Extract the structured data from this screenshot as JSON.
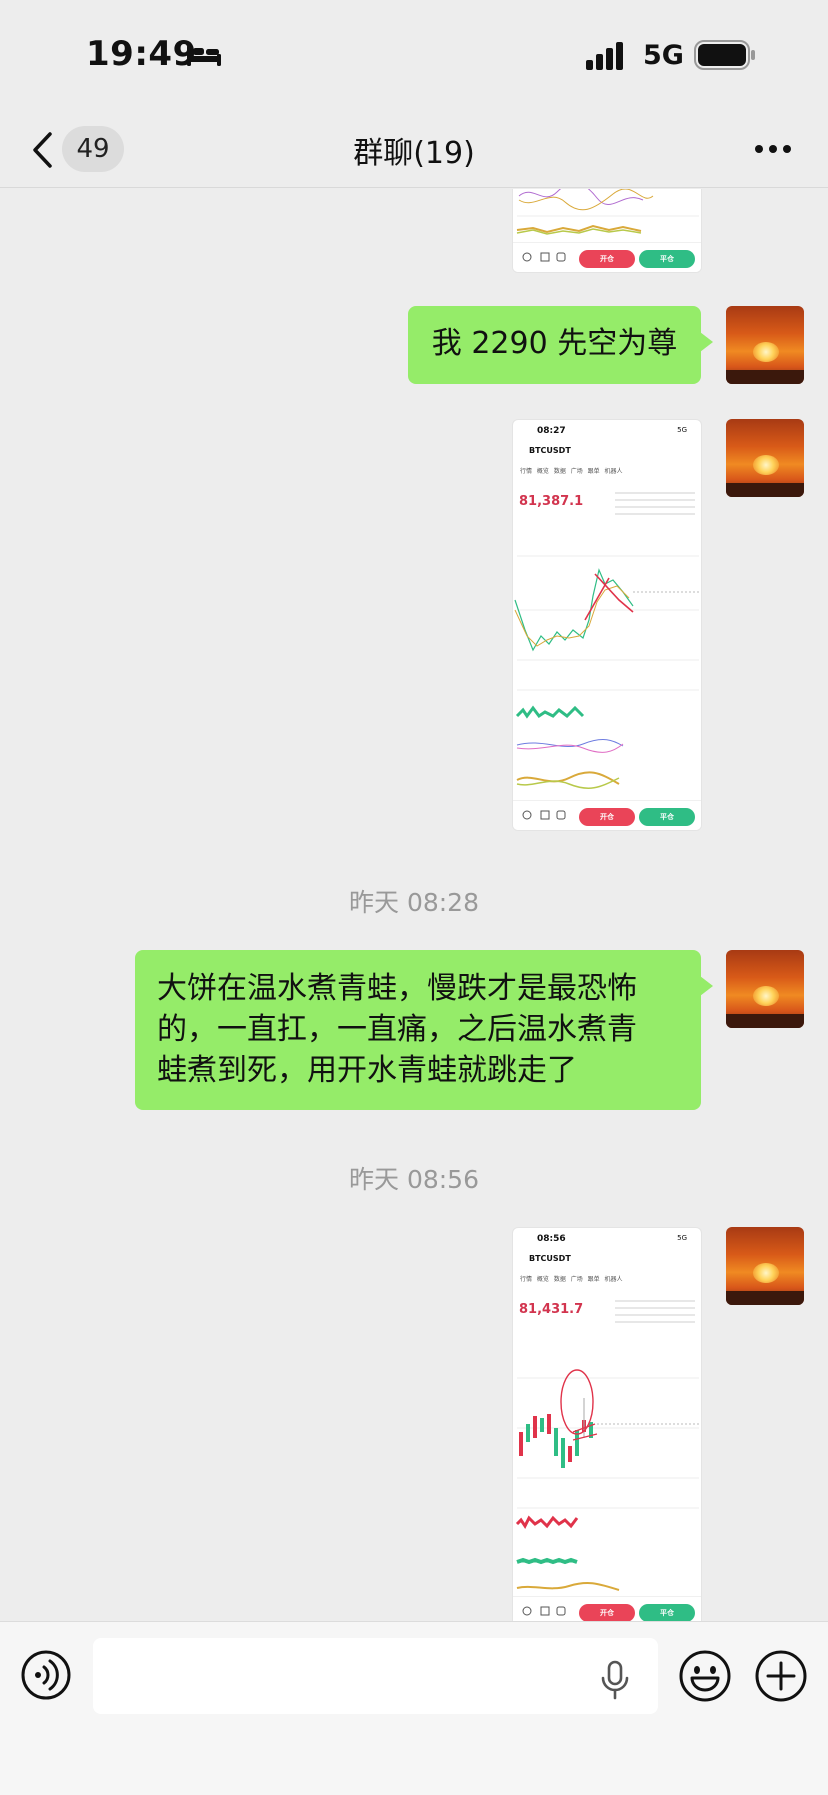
{
  "status_bar": {
    "time": "19:49",
    "network": "5G",
    "icons": [
      "bed-icon",
      "signal-icon",
      "battery-icon"
    ]
  },
  "header": {
    "back_icon": "chevron-left-icon",
    "unread_count": "49",
    "title": "群聊(19)",
    "more_icon": "more-dots-icon"
  },
  "messages": [
    {
      "type": "image",
      "partial": true,
      "content": "trading-app-screenshot",
      "buttons": [
        "开仓",
        "平仓"
      ]
    },
    {
      "type": "text",
      "text": "我 2290 先空为尊"
    },
    {
      "type": "image",
      "content": "trading-app-screenshot",
      "shot": {
        "time": "08:27",
        "network": "5G",
        "pair": "BTCUSDT",
        "tabs": "行情 概览 数据 广场 跟单 机器人",
        "price": "81,387.1"
      },
      "buttons": [
        "开仓",
        "平仓"
      ]
    },
    {
      "type": "timestamp",
      "text": "昨天 08:28"
    },
    {
      "type": "text",
      "lines": [
        "大饼在温水煮青蛙，慢跌才是最恐怖",
        "的，一直扛，一直痛，之后温水煮青",
        "蛙煮到死，用开水青蛙就跳走了"
      ]
    },
    {
      "type": "timestamp",
      "text": "昨天 08:56"
    },
    {
      "type": "image",
      "content": "trading-app-screenshot",
      "shot": {
        "time": "08:56",
        "network": "5G",
        "pair": "BTCUSDT",
        "tabs": "行情 概览 数据 广场 跟单 机器人",
        "price": "81,431.7"
      },
      "buttons": [
        "开仓",
        "平仓"
      ]
    }
  ],
  "input_bar": {
    "voice_icon": "voice-icon",
    "mic_icon": "mic-icon",
    "emoji_icon": "emoji-icon",
    "plus_icon": "plus-icon"
  },
  "colors": {
    "bubble_green": "#95ec69",
    "background": "#ededed",
    "sell_red": "#ea4458",
    "buy_green": "#2fbd85"
  }
}
